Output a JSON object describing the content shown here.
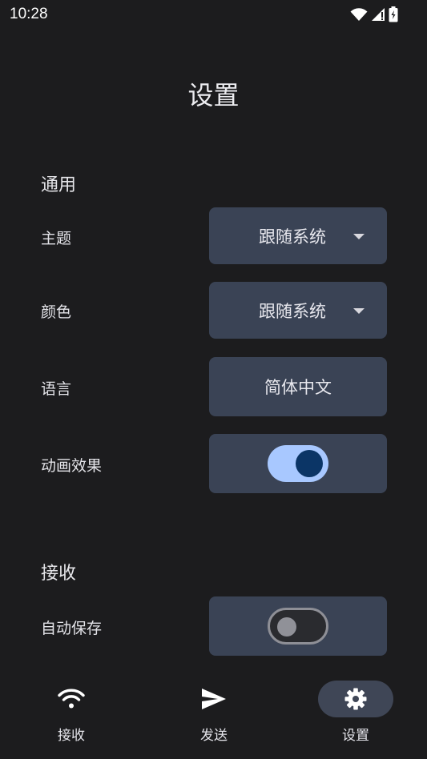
{
  "status_bar": {
    "time": "10:28"
  },
  "header": {
    "title": "设置"
  },
  "sections": {
    "general": {
      "title": "通用",
      "theme_label": "主题",
      "theme_value": "跟随系统",
      "color_label": "颜色",
      "color_value": "跟随系统",
      "language_label": "语言",
      "language_value": "简体中文",
      "animation_label": "动画效果",
      "animation_on": true
    },
    "receive": {
      "title": "接收",
      "autosave_label": "自动保存",
      "autosave_on": false
    }
  },
  "bottom_nav": {
    "items": [
      {
        "label": "接收",
        "icon": "wifi-icon",
        "active": false
      },
      {
        "label": "发送",
        "icon": "send-icon",
        "active": false
      },
      {
        "label": "设置",
        "icon": "gear-icon",
        "active": true
      }
    ]
  },
  "colors": {
    "background": "#1c1c1e",
    "control_bg": "#3a4355",
    "switch_on_track": "#a8c8ff",
    "switch_on_knob": "#0b3566",
    "nav_active_pill": "#3f4656"
  }
}
